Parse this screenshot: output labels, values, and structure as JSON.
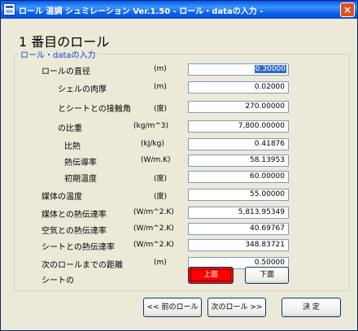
{
  "window": {
    "title": "ロール 温調 シュミレーション  Ver.1.50 - ロール・dataの入力 -",
    "close_glyph": "×"
  },
  "heading": "1 番目のロール",
  "group_title": "ロール・dataの入力",
  "fields": [
    {
      "label": "ロールの直径",
      "unit": "(m)",
      "value": "0.30000"
    },
    {
      "label": "シェルの肉厚",
      "unit": "(m)",
      "value": "0.02000"
    },
    {
      "label": "とシートとの接触角",
      "unit": "(度)",
      "value": "270.00000"
    },
    {
      "label": "の比重",
      "unit": "(kg/m^3)",
      "value": "7,800.00000"
    },
    {
      "label": "比熱",
      "unit": "(kJ/kg)",
      "value": "0.41876"
    },
    {
      "label": "熱伝導率",
      "unit": "(W/m.K)",
      "value": "58.13953"
    },
    {
      "label": "初期温度",
      "unit": "(度)",
      "value": "60.00000"
    },
    {
      "label": "媒体の温度",
      "unit": "(度)",
      "value": "55.00000"
    },
    {
      "label": "媒体との熱伝達率",
      "unit": "(W/m^2.K)",
      "value": "5,813.95349"
    },
    {
      "label": "空気との熱伝達率",
      "unit": "(W/m^2.K)",
      "value": "40.69767"
    },
    {
      "label": "シートとの熱伝達率",
      "unit": "(W/m^2.K)",
      "value": "348.83721"
    },
    {
      "label": "次のロールまでの距離",
      "unit": "(m)",
      "value": "0.50000"
    }
  ],
  "sheet": {
    "label": "シートの",
    "top_button": "上面",
    "bottom_button": "下面",
    "active_color": "#ff0000"
  },
  "footer": {
    "prev_button": "<< 前のロール",
    "next_button": "次のロール >>",
    "confirm_button": "決  定"
  }
}
